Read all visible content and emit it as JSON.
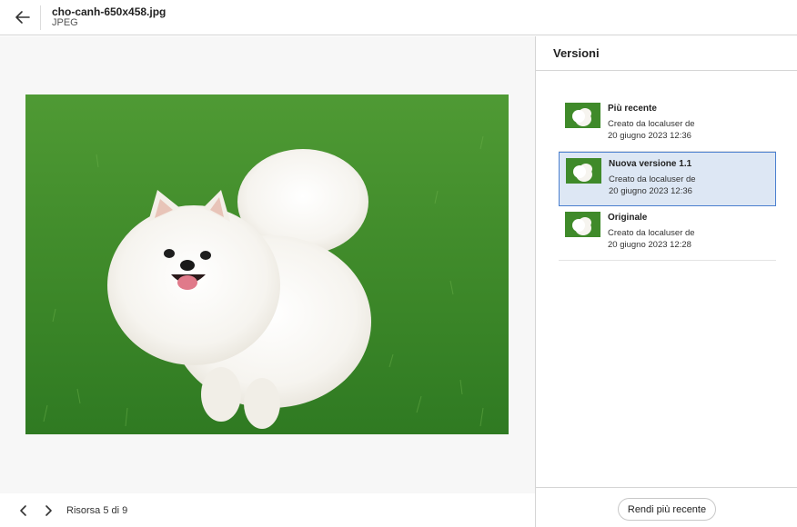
{
  "header": {
    "file_name": "cho-canh-650x458.jpg",
    "file_type": "JPEG",
    "back_icon": "arrow-left-icon"
  },
  "preview": {
    "image_subject": "white pomeranian dog on grass",
    "colors": {
      "grass": "#3f8a2c",
      "background": "#f7f7f7"
    }
  },
  "footer": {
    "prev_icon": "chevron-left-icon",
    "next_icon": "chevron-right-icon",
    "asset_counter": "Risorsa 5 di 9"
  },
  "versions": {
    "title": "Versioni",
    "items": [
      {
        "name": "Più recente",
        "created_by": "Creato da localuser de",
        "date": "20 giugno 2023 12:36",
        "selected": false
      },
      {
        "name": "Nuova versione 1.1",
        "created_by": "Creato da localuser de",
        "date": "20 giugno 2023 12:36",
        "selected": true
      },
      {
        "name": "Originale",
        "created_by": "Creato da localuser de",
        "date": "20 giugno 2023 12:28",
        "selected": false
      }
    ],
    "make_current_label": "Rendi più recente",
    "selected_color": "#dde7f4",
    "selected_border": "#4a7fcf"
  }
}
